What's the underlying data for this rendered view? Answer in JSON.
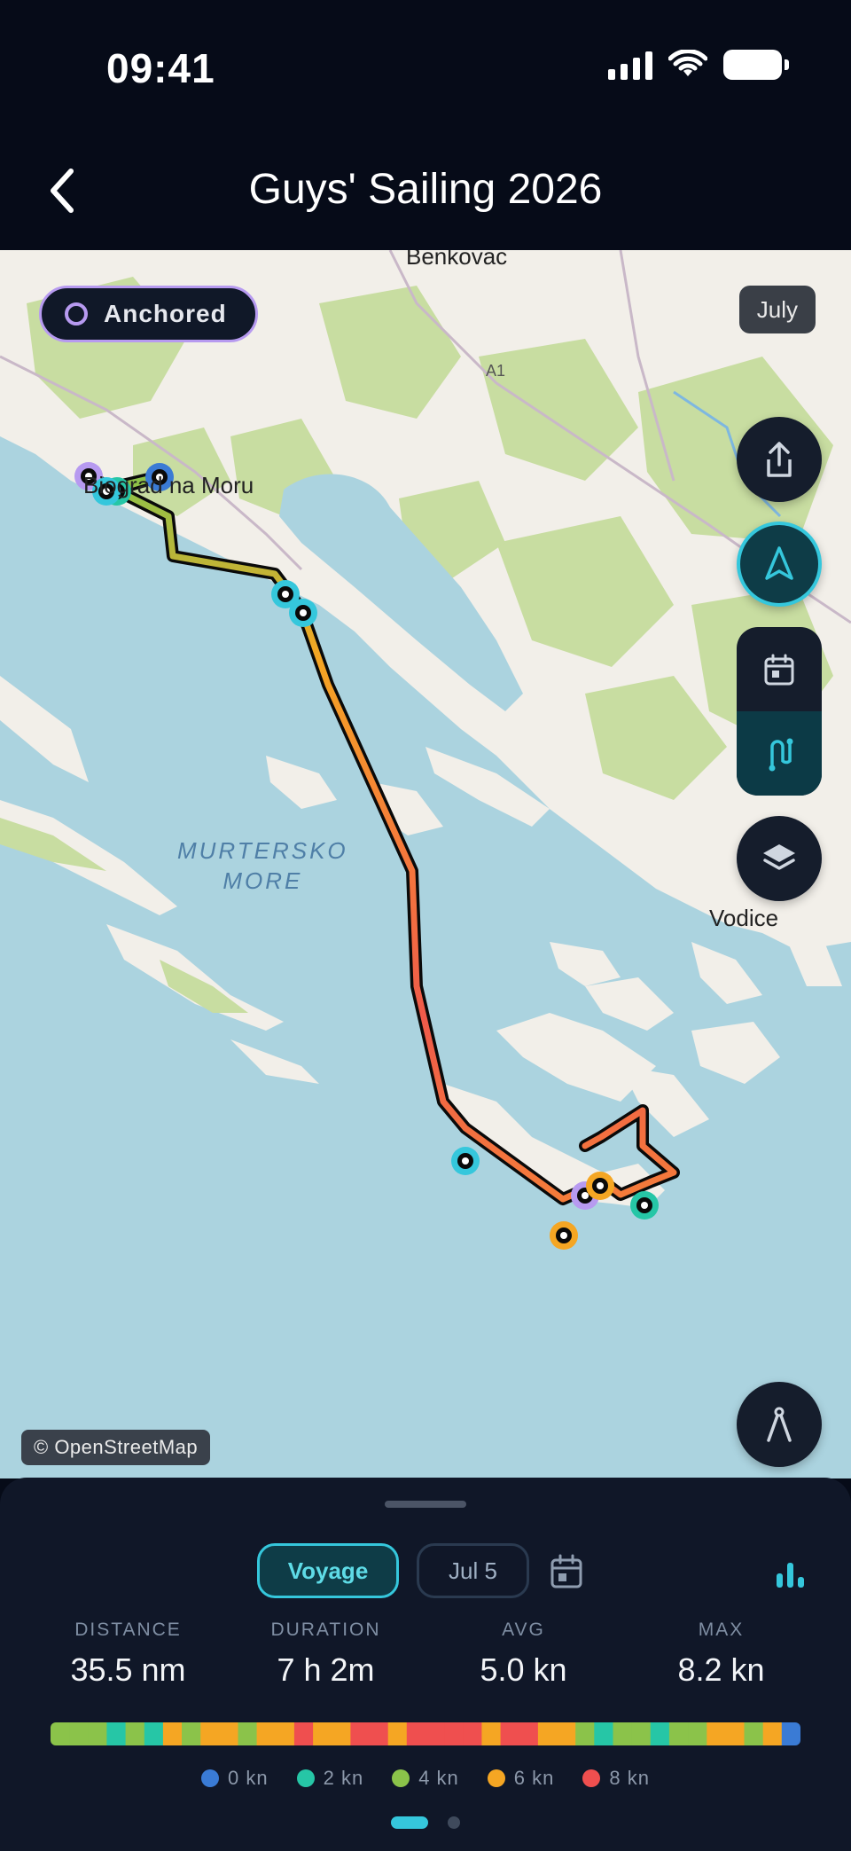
{
  "status_bar": {
    "time": "09:41"
  },
  "header": {
    "title": "Guys' Sailing 2026"
  },
  "map": {
    "status_pill": "Anchored",
    "month_chip": "July",
    "labels": {
      "town_top": "Benkovac",
      "highway": "A1",
      "town_marina": "Biograd na Moru",
      "town_right": "Vodice",
      "sea_line1": "MURTERSKO",
      "sea_line2": "MORE"
    },
    "attribution": "© OpenStreetMap",
    "colors": {
      "water": "#abd3df",
      "land": "#f2efe9",
      "forest": "#c8dda1",
      "accent": "#35c7dc"
    },
    "buttons": [
      "share-icon",
      "navigate-icon",
      "calendar-icon",
      "route-icon",
      "layers-icon",
      "compass-icon"
    ]
  },
  "sheet": {
    "tab_voyage": "Voyage",
    "tab_date": "Jul 5",
    "stats": [
      {
        "label": "DISTANCE",
        "value": "35.5 nm"
      },
      {
        "label": "DURATION",
        "value": "7 h 2m"
      },
      {
        "label": "AVG",
        "value": "5.0 kn"
      },
      {
        "label": "MAX",
        "value": "8.2 kn"
      }
    ],
    "legend": [
      {
        "label": "0 kn",
        "color": "#3a7bd5"
      },
      {
        "label": "2 kn",
        "color": "#26c6a6"
      },
      {
        "label": "4 kn",
        "color": "#8bc34a"
      },
      {
        "label": "6 kn",
        "color": "#f5a623"
      },
      {
        "label": "8 kn",
        "color": "#ef4f4f"
      }
    ],
    "page_indicator": {
      "current": 1,
      "total": 2
    }
  }
}
